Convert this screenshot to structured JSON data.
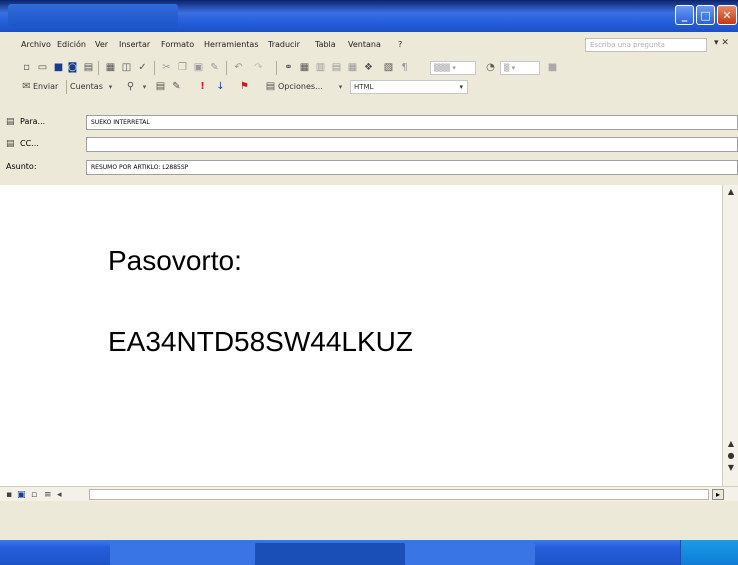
{
  "window": {
    "minimize_glyph": "_",
    "maximize_glyph": "□",
    "close_glyph": "✕"
  },
  "menu": {
    "items": [
      "Archivo",
      "Edición",
      "Ver",
      "Insertar",
      "Formato",
      "Herramientas",
      "Traducir",
      "Tabla",
      "Ventana",
      "?"
    ],
    "help_placeholder": "Escriba una pregunta",
    "help_close": "▾ ✕"
  },
  "toolbar2": {
    "send_label": "Enviar",
    "accounts_label": "Cuentas",
    "options_label": "Opciones...",
    "format_value": "HTML"
  },
  "header": {
    "to_label": "Para...",
    "to_value": "SUEKO INTERRETAL",
    "cc_label": "CC...",
    "cc_value": "",
    "subject_label": "Asunto:",
    "subject_value": "RESUMO POR ARTIKLO: L2885SP"
  },
  "body": {
    "line1": "Pasovorto:",
    "line2": "EA34NTD58SW44LKUZ"
  },
  "icons": {
    "standard": [
      "new-icon",
      "open-icon",
      "save-icon",
      "attach-icon",
      "print-icon",
      "preview-icon",
      "spell-icon",
      "cut-icon",
      "copy-icon",
      "paste-icon",
      "format-painter-icon",
      "undo-icon",
      "redo-icon",
      "hyperlink-icon",
      "table-icon",
      "columns-icon",
      "drawing-icon",
      "paragraph-icon",
      "zoom-icon"
    ]
  },
  "colors": {
    "title_bar": "#245edb",
    "close_button": "#c23a13",
    "taskbar": "#245edb"
  }
}
